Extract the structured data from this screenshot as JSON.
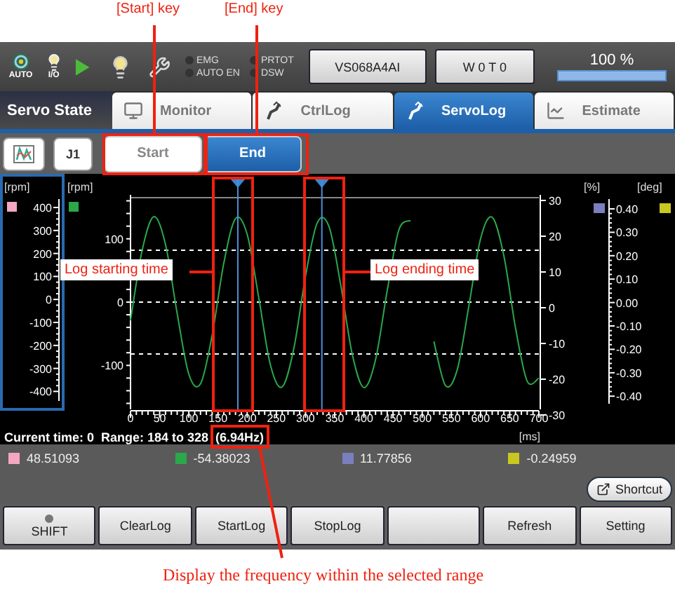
{
  "callouts": [
    {
      "text": "[Start] key"
    },
    {
      "text": "[End] key"
    },
    {
      "text": "Log starting time"
    },
    {
      "text": "Log ending time"
    },
    {
      "text": "Display the frequency within the selected range"
    }
  ],
  "toolbar": {
    "mode_label": "AUTO",
    "io_label": "I/O",
    "status_lamps": [
      {
        "label": "EMG",
        "on": false
      },
      {
        "label": "AUTO EN",
        "on": false
      },
      {
        "label": "PRTOT",
        "on": false
      },
      {
        "label": "DSW",
        "on": false
      }
    ],
    "robot_button": "VS068A4AI",
    "tool_button": "W 0 T 0",
    "speed": {
      "reading": "100 %",
      "level": 1
    }
  },
  "tabs_bar": {
    "title": "Servo State",
    "tabs": [
      {
        "label": "Monitor",
        "selected": false
      },
      {
        "label": "CtrlLog",
        "selected": false
      },
      {
        "label": "ServoLog",
        "selected": true
      },
      {
        "label": "Estimate",
        "selected": false
      }
    ]
  },
  "log_bar": {
    "joint": "J1",
    "keys": [
      {
        "label": "Start",
        "selected": false
      },
      {
        "label": "End",
        "selected": true
      }
    ]
  },
  "chart": {
    "left_scale": {
      "unit": "[rpm]",
      "color": "#f4a7c0",
      "labels": [
        "400",
        "300",
        "200",
        "100",
        "0",
        "-100",
        "-200",
        "-300",
        "-400"
      ]
    },
    "chart_data": {
      "type": "line",
      "ylabel": "[rpm]",
      "xlabel": "[ms]",
      "xlim": [
        0,
        700
      ],
      "ylim": [
        -165,
        165
      ],
      "x": [
        0,
        20,
        40,
        60,
        80,
        100,
        120,
        140,
        160,
        180,
        200,
        220,
        240,
        260,
        280,
        300,
        320,
        340,
        360,
        380,
        400,
        420,
        440,
        460,
        480,
        500,
        520,
        540,
        560,
        580,
        600,
        620,
        640,
        660,
        680,
        700
      ],
      "series": [
        {
          "color": "#2aa84a",
          "values": [
            -29,
            82,
            135,
            91,
            -18,
            -114,
            -129,
            -52,
            62,
            132,
            107,
            6,
            -100,
            -134,
            -73,
            41,
            125,
            120,
            29,
            -82,
            -135,
            -91,
            18,
            114,
            129,
            null,
            -62,
            -132,
            -107,
            -6,
            100,
            134,
            73,
            -41,
            -125,
            -120
          ]
        }
      ],
      "xticks": [
        0,
        50,
        100,
        150,
        200,
        250,
        300,
        350,
        400,
        450,
        500,
        550,
        600,
        650,
        700
      ],
      "yticks": [
        100,
        0,
        -100
      ],
      "ref_lines": [
        {
          "axis": "x",
          "value": 184
        },
        {
          "axis": "x",
          "value": 328
        }
      ]
    },
    "right_axis_ticks": [
      "30",
      "20",
      "10",
      "0",
      "-10",
      "-20",
      "-30"
    ],
    "right_scales": [
      {
        "unit": "[%]",
        "color": "#7a7fc0"
      },
      {
        "unit": "[deg]",
        "color": "#c8c820"
      }
    ],
    "right_scale_labels": [
      "0.40",
      "0.30",
      "0.20",
      "0.10",
      "0.00",
      "-0.10",
      "-0.20",
      "-0.30",
      "-0.40"
    ],
    "status": {
      "current_time": "Current time: 0",
      "range": "Range: 184 to 328",
      "frequency": "(6.94Hz)"
    }
  },
  "values": [
    {
      "color": "#f4a7c0",
      "value": "48.51093"
    },
    {
      "color": "#2aa84a",
      "value": "-54.38023"
    },
    {
      "color": "#7a7fc0",
      "value": "11.77856"
    },
    {
      "color": "#c8c820",
      "value": "-0.24959"
    }
  ],
  "shortcut": "Shortcut",
  "function_keys": [
    {
      "kind": "shift",
      "label": "SHIFT",
      "lamp_on": false
    },
    {
      "kind": "key",
      "label": "ClearLog"
    },
    {
      "kind": "key",
      "label": "StartLog"
    },
    {
      "kind": "key",
      "label": "StopLog"
    },
    {
      "kind": "blank"
    },
    {
      "kind": "key",
      "label": "Refresh"
    },
    {
      "kind": "key",
      "label": "Setting"
    }
  ]
}
